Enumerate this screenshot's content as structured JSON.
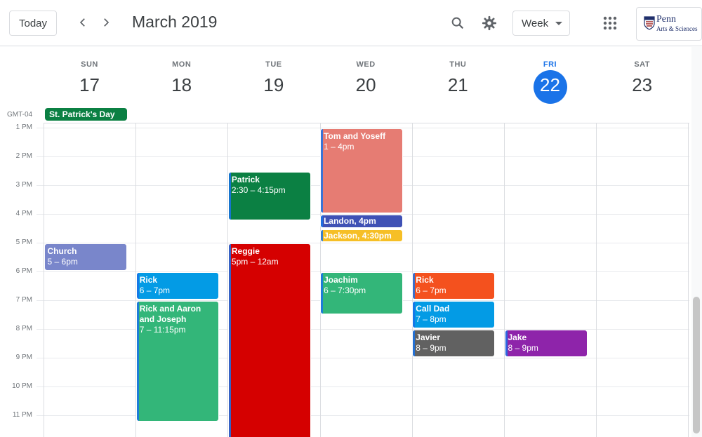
{
  "header": {
    "today_label": "Today",
    "month_title": "March 2019",
    "view_label": "Week",
    "logo_text_1": "Penn",
    "logo_text_2": "Arts & Sciences"
  },
  "timezone": "GMT-04",
  "days": [
    {
      "name": "SUN",
      "num": "17"
    },
    {
      "name": "MON",
      "num": "18"
    },
    {
      "name": "TUE",
      "num": "19"
    },
    {
      "name": "WED",
      "num": "20"
    },
    {
      "name": "THU",
      "num": "21"
    },
    {
      "name": "FRI",
      "num": "22",
      "today": true
    },
    {
      "name": "SAT",
      "num": "23"
    }
  ],
  "allday": [
    {
      "title": "St. Patrick's Day",
      "day": 0,
      "color": "#0b8043"
    }
  ],
  "hours": [
    "1 PM",
    "2 PM",
    "3 PM",
    "4 PM",
    "5 PM",
    "6 PM",
    "7 PM",
    "8 PM",
    "9 PM",
    "10 PM",
    "11 PM"
  ],
  "events": [
    {
      "title": "Tom and Yoseff",
      "time": "1 – 4pm",
      "day": 3,
      "start": 13,
      "end": 16,
      "color": "#e67c73"
    },
    {
      "title": "Patrick",
      "time": "2:30 – 4:15pm",
      "day": 2,
      "start": 14.5,
      "end": 16.25,
      "color": "#0b8043"
    },
    {
      "title": "Landon",
      "time": ", 4pm",
      "day": 3,
      "start": 16,
      "end": 16.5,
      "color": "#3f51b5",
      "inline": true
    },
    {
      "title": "Jackson",
      "time": ", 4:30pm",
      "day": 3,
      "start": 16.5,
      "end": 17,
      "color": "#f6bf26",
      "inline": true
    },
    {
      "title": "Church",
      "time": "5 – 6pm",
      "day": 0,
      "start": 17,
      "end": 18,
      "color": "#7986cb"
    },
    {
      "title": "Reggie",
      "time": "5pm – 12am",
      "day": 2,
      "start": 17,
      "end": 24,
      "color": "#d50000"
    },
    {
      "title": "Rick",
      "time": "6 – 7pm",
      "day": 1,
      "start": 18,
      "end": 19,
      "color": "#039be5"
    },
    {
      "title": "Joachim",
      "time": "6 – 7:30pm",
      "day": 3,
      "start": 18,
      "end": 19.5,
      "color": "#33b679"
    },
    {
      "title": "Rick",
      "time": "6 – 7pm",
      "day": 4,
      "start": 18,
      "end": 19,
      "color": "#f4511e"
    },
    {
      "title": "Rick and Aaron and Joseph",
      "time": "7 – 11:15pm",
      "day": 1,
      "start": 19,
      "end": 23.25,
      "color": "#33b679"
    },
    {
      "title": "Call Dad",
      "time": "7 – 8pm",
      "day": 4,
      "start": 19,
      "end": 20,
      "color": "#039be5"
    },
    {
      "title": "Javier",
      "time": "8 – 9pm",
      "day": 4,
      "start": 20,
      "end": 21,
      "color": "#616161"
    },
    {
      "title": "Jake",
      "time": "8 – 9pm",
      "day": 5,
      "start": 20,
      "end": 21,
      "color": "#8e24aa"
    }
  ]
}
